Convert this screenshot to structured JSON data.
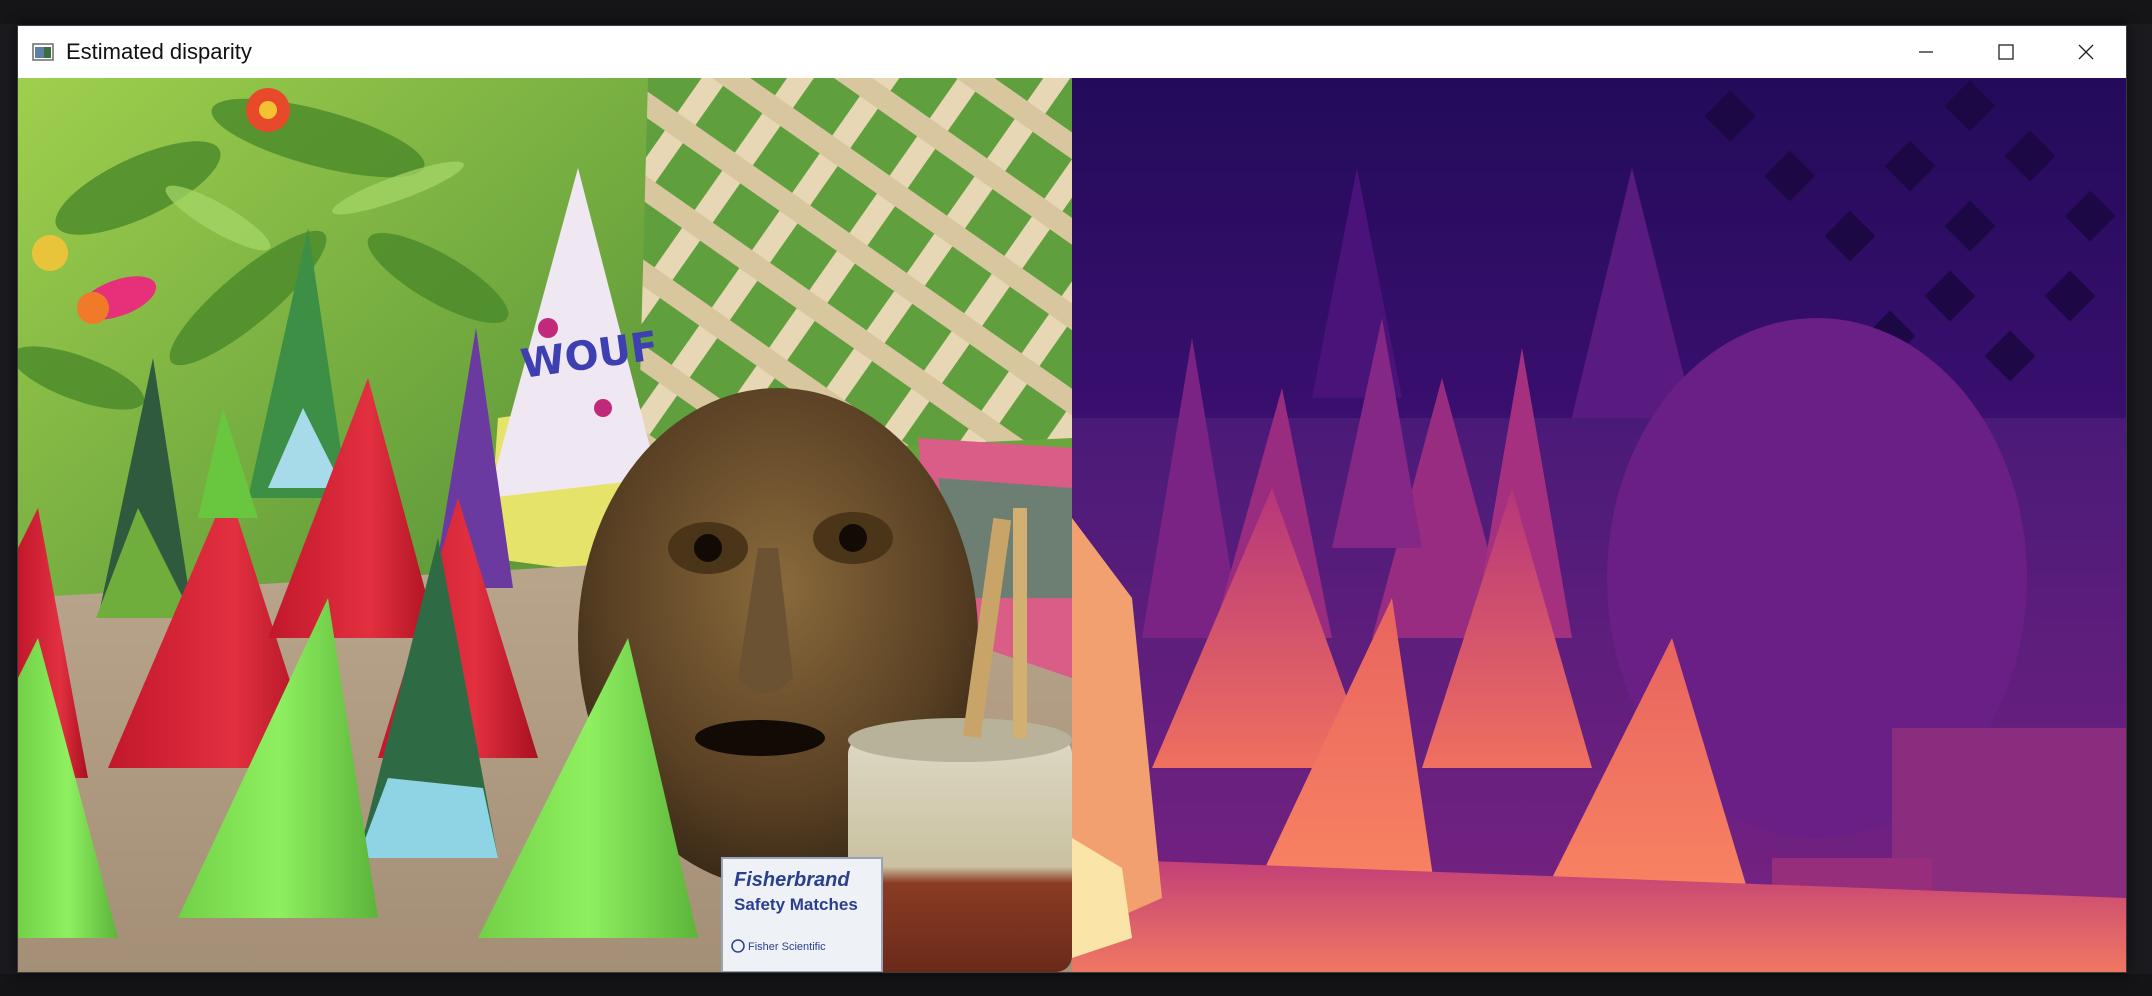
{
  "window": {
    "title": "Estimated disparity",
    "icon": "image-window-icon",
    "controls": {
      "minimize_icon": "minimize-icon",
      "maximize_icon": "maximize-icon",
      "close_icon": "close-icon"
    }
  },
  "panels": [
    {
      "name": "left-stereo-image",
      "content": "photo of party cones, a wooden mask, a mug and a Fisherbrand Safety Matches box"
    },
    {
      "name": "disparity-map",
      "content": "magma-colormap disparity map"
    }
  ],
  "matchbox": {
    "brand": "Fisherbrand",
    "product": "Safety Matches",
    "maker": "Fisher Scientific"
  },
  "hat_text": "WOUF",
  "colors": {
    "titlebar_bg": "#ffffff",
    "background": "#1c1c1e",
    "magma_dark": "#3b0f70",
    "magma_mid": "#8c2981",
    "magma_light": "#f8765c"
  }
}
